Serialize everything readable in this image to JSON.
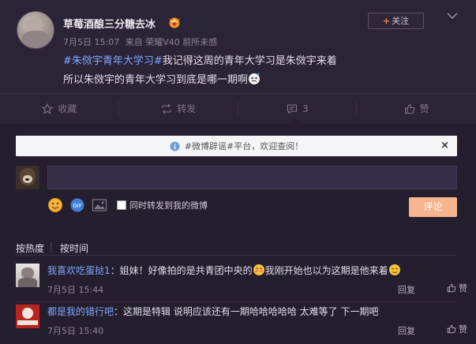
{
  "post": {
    "username": "草莓酒酿三分糖去冰",
    "date": "7月5日 15:07",
    "source": "来自 荣耀V40 前所未感",
    "follow_label": "关注",
    "topic": "#朱傚宇青年大学习#",
    "text_line1": "我记得这周的青年大学习是朱傚宇来着",
    "text_line2": "所以朱傚宇的青年大学习到底是哪一期啊"
  },
  "actions": {
    "favorite": "收藏",
    "repost": "转发",
    "comment_count": "3",
    "like": "赞"
  },
  "notice": {
    "text": "#微博辟谣#平台，欢迎查阅！",
    "close": "×"
  },
  "composer": {
    "forward_checkbox_label": "同时转发到我的微博",
    "submit_label": "评论"
  },
  "sort": {
    "by_hot": "按热度",
    "by_time": "按时间"
  },
  "comments": [
    {
      "nick": "我喜欢吃蛋挞1",
      "text_a": "：姐妹！好像拍的是共青团中央的",
      "text_b": "我刚开始也以为这期是他来着",
      "time": "7月5日 15:44",
      "reply": "回复",
      "like": "赞"
    },
    {
      "nick": "都是我的错行吧",
      "text_a": "：这期是特辑 说明应该还有一期哈哈哈哈哈 太难等了 下一期吧",
      "text_b": "",
      "time": "7月5日 15:40",
      "reply": "回复",
      "like": "赞"
    }
  ],
  "colors": {
    "background": "#2b2336",
    "topic_link": "#7fa7ff",
    "accent_orange": "#ff8140",
    "submit_button": "#f6b48f"
  },
  "icons": [
    "chevron-down-icon",
    "star-icon",
    "repost-icon",
    "comment-icon",
    "thumbs-up-icon",
    "info-icon",
    "emoji-icon",
    "gif-icon",
    "image-icon",
    "vip-icon"
  ]
}
